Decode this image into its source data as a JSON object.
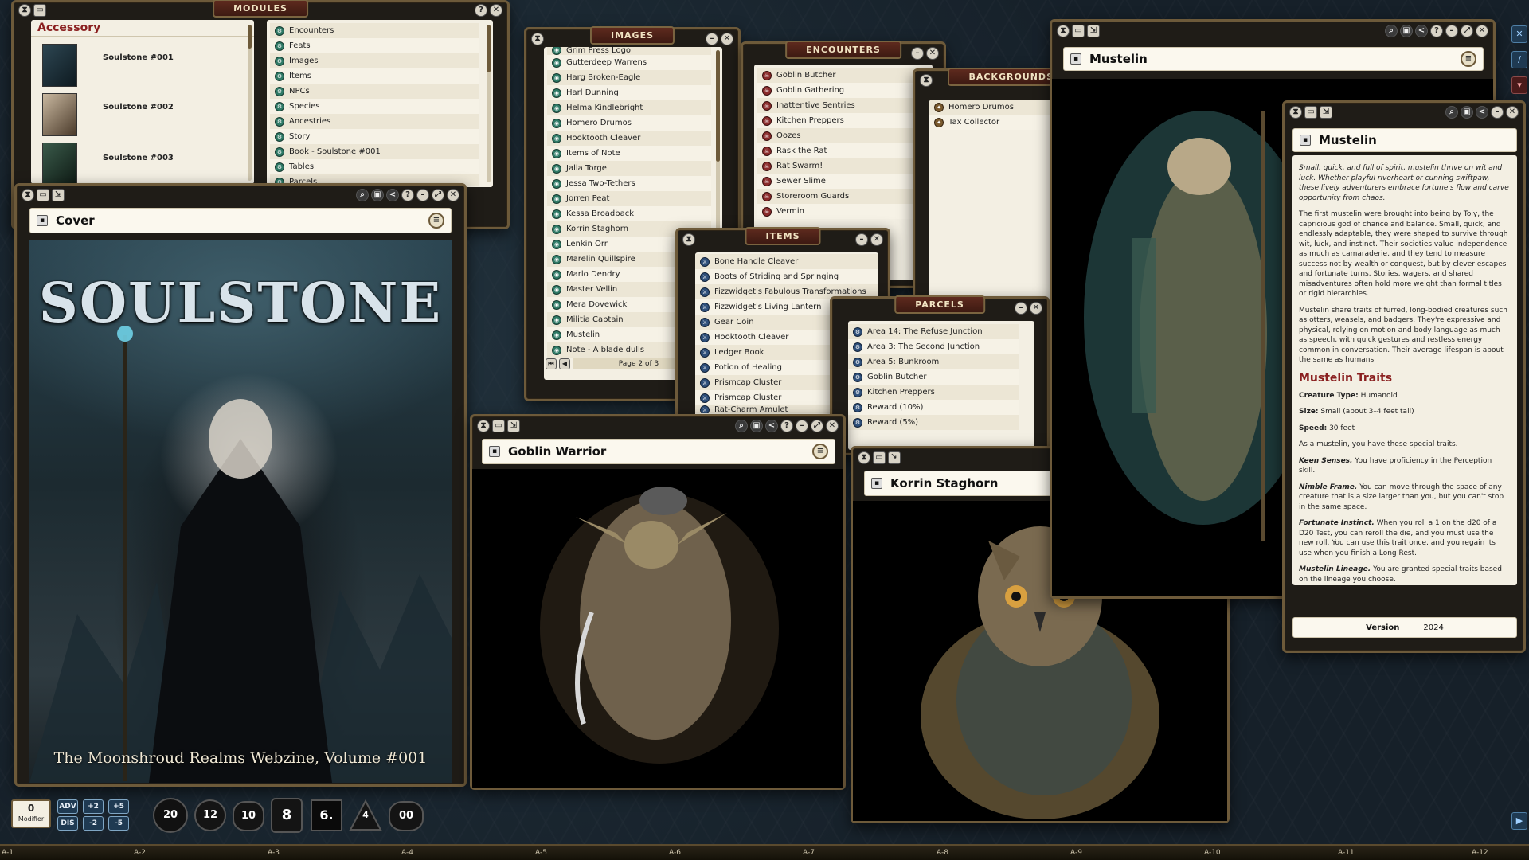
{
  "colors": {
    "accent": "#6d5a3a",
    "title_red": "#8a1f1f",
    "paper": "#f3efe3"
  },
  "modules": {
    "title": "MODULES",
    "accessory_header": "Accessory",
    "covers": [
      "Soulstone #001",
      "Soulstone #002",
      "Soulstone #003"
    ],
    "categories": [
      "Encounters",
      "Feats",
      "Images",
      "Items",
      "NPCs",
      "Species",
      "Ancestries",
      "Story",
      "Book - Soulstone #001",
      "Tables",
      "Parcels"
    ]
  },
  "cover": {
    "window_title": "Cover",
    "art_title": "SOULSTONE",
    "subtitle": "The Moonshroud Realms Webzine, Volume #001"
  },
  "images": {
    "title": "IMAGES",
    "items": [
      "Grim Press Logo",
      "Gutterdeep Warrens",
      "Harg Broken-Eagle",
      "Harl Dunning",
      "Helma Kindlebright",
      "Homero Drumos",
      "Hooktooth Cleaver",
      "Items of Note",
      "Jalla Torge",
      "Jessa Two-Tethers",
      "Jorren Peat",
      "Kessa Broadback",
      "Korrin Staghorn",
      "Lenkin Orr",
      "Marelin Quillspire",
      "Marlo Dendry",
      "Master Vellin",
      "Mera Dovewick",
      "Militia Captain",
      "Mustelin",
      "Note - A blade dulls"
    ],
    "page_label": "Page 2 of 3"
  },
  "encounters": {
    "title": "ENCOUNTERS",
    "items": [
      "Goblin Butcher",
      "Goblin Gathering",
      "Inattentive Sentries",
      "Kitchen Preppers",
      "Oozes",
      "Rask the Rat",
      "Rat Swarm!",
      "Sewer Slime",
      "Storeroom Guards",
      "Vermin"
    ]
  },
  "backgrounds": {
    "title": "BACKGROUNDS",
    "items": [
      "Homero Drumos",
      "Tax Collector"
    ]
  },
  "items": {
    "title": "ITEMS",
    "items": [
      "Bone Handle Cleaver",
      "Boots of Striding and Springing",
      "Fizzwidget's Fabulous Transformations",
      "Fizzwidget's Living Lantern",
      "Gear Coin",
      "Hooktooth Cleaver",
      "Ledger Book",
      "Potion of Healing",
      "Prismcap Cluster",
      "Prismcap Cluster",
      "Rat-Charm Amulet"
    ]
  },
  "parcels": {
    "title": "PARCELS",
    "items": [
      "Area 14: The Refuse Junction",
      "Area 3: The Second Junction",
      "Area 5: Bunkroom",
      "Goblin Butcher",
      "Kitchen Preppers",
      "Reward (10%)",
      "Reward (5%)"
    ]
  },
  "goblin": {
    "window_title": "Goblin Warrior"
  },
  "korrin": {
    "window_title": "Korrin Staghorn"
  },
  "mustelin_image": {
    "window_title": "Mustelin"
  },
  "mustelin_story": {
    "window_title": "Mustelin",
    "intro": "Small, quick, and full of spirit, mustelin thrive on wit and luck. Whether playful riverheart or cunning swiftpaw, these lively adventurers embrace fortune's flow and carve opportunity from chaos.",
    "p1": "The first mustelin were brought into being by Toiy, the capricious god of chance and balance. Small, quick, and endlessly adaptable, they were shaped to survive through wit, luck, and instinct. Their societies value independence as much as camaraderie, and they tend to measure success not by wealth or conquest, but by clever escapes and fortunate turns. Stories, wagers, and shared misadventures often hold more weight than formal titles or rigid hierarchies.",
    "p2": "Mustelin share traits of furred, long-bodied creatures such as otters, weasels, and badgers. They're expressive and physical, relying on motion and body language as much as speech, with quick gestures and restless energy common in conversation. Their average lifespan is about the same as humans.",
    "traits_heading": "Mustelin Traits",
    "creature_type_label": "Creature Type:",
    "creature_type": "Humanoid",
    "size_label": "Size:",
    "size": "Small (about 3–4 feet tall)",
    "speed_label": "Speed:",
    "speed": "30 feet",
    "as_line": "As a mustelin, you have these special traits.",
    "keen_label": "Keen Senses.",
    "keen": "You have proficiency in the Perception skill.",
    "nimble_label": "Nimble Frame.",
    "nimble": "You can move through the space of any creature that is a size larger than you, but you can't stop in the same space.",
    "fortunate_label": "Fortunate Instinct.",
    "fortunate": "When you roll a 1 on the d20 of a D20 Test, you can reroll the die, and you must use the new roll. You can use this trait once, and you regain its use when you finish a Long Rest.",
    "lineage_label": "Mustelin Lineage.",
    "lineage": "You are granted special traits based on the lineage you choose.",
    "version_label": "Version",
    "version": "2024"
  },
  "toolbar": {
    "modifier_value": "0",
    "modifier_label": "Modifier",
    "adv": "ADV",
    "dis": "DIS",
    "plus2": "+2",
    "plus5": "+5",
    "minus2": "-2",
    "minus5": "-5",
    "dice": [
      "20",
      "12",
      "10",
      "8",
      "6.",
      "4",
      "00"
    ]
  },
  "grid_labels": [
    "A-1",
    "A-2",
    "A-3",
    "A-4",
    "A-5",
    "A-6",
    "A-7",
    "A-8",
    "A-9",
    "A-10",
    "A-11",
    "A-12"
  ]
}
